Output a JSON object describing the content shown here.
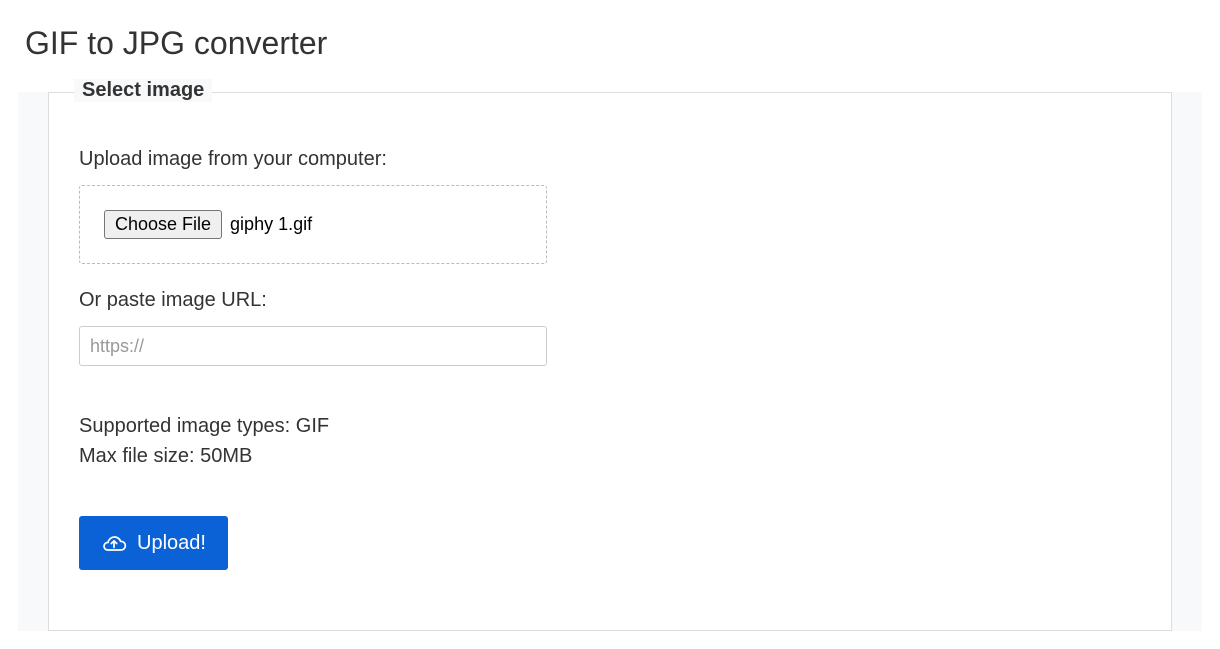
{
  "page": {
    "title": "GIF to JPG converter"
  },
  "form": {
    "legend": "Select image",
    "upload_label": "Upload image from your computer:",
    "choose_file_button": "Choose File",
    "selected_file_name": "giphy 1.gif",
    "url_label": "Or paste image URL:",
    "url_placeholder": "https://",
    "url_value": "",
    "supported_types": "Supported image types: GIF",
    "max_size": "Max file size: 50MB",
    "upload_button": "Upload!"
  }
}
